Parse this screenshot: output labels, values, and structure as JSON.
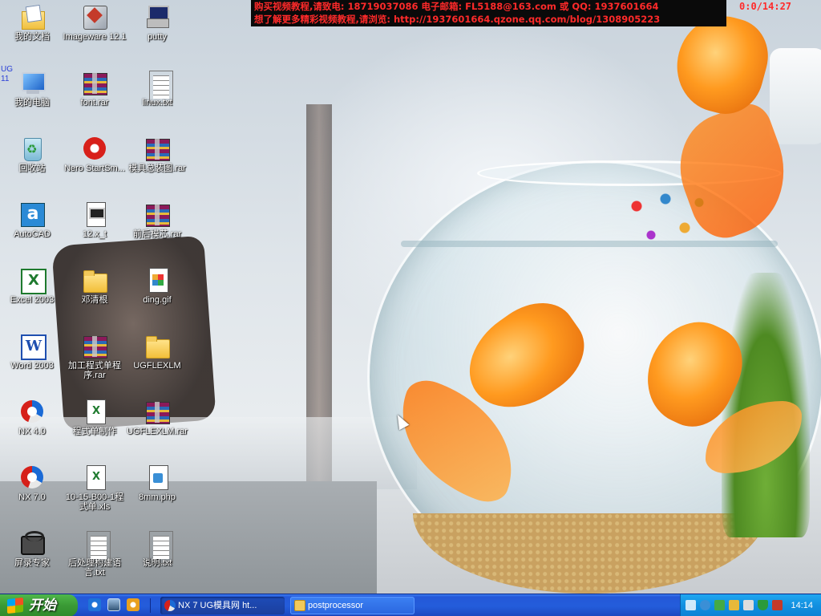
{
  "banner": {
    "line1": "购买视频教程,请致电: 18719037086 电子邮箱: FL5188@163.com 或 QQ: 1937601664",
    "line2": "想了解更多精彩视频教程,请浏览: http://1937601664.qzone.qq.com/blog/1308905223",
    "timer": "0:0/14:27"
  },
  "ug_label": "UG 11",
  "desktop": {
    "icons": [
      {
        "label": "我的文档",
        "icon": "my-documents-icon"
      },
      {
        "label": "Imageware 12.1",
        "icon": "imageware-icon"
      },
      {
        "label": "putty",
        "icon": "putty-icon"
      },
      {
        "label": "我的电脑",
        "icon": "my-computer-icon"
      },
      {
        "label": "font.rar",
        "icon": "rar-archive-icon"
      },
      {
        "label": "linux.txt",
        "icon": "text-file-icon"
      },
      {
        "label": "回收站",
        "icon": "recycle-bin-icon"
      },
      {
        "label": "Nero StartSm...",
        "icon": "nero-icon"
      },
      {
        "label": "模具总装图.rar",
        "icon": "rar-archive-icon"
      },
      {
        "label": "AutoCAD",
        "icon": "autocad-icon"
      },
      {
        "label": "12.x_t",
        "icon": "model-file-icon"
      },
      {
        "label": "前后模芯.rar",
        "icon": "rar-archive-icon"
      },
      {
        "label": "Excel 2003",
        "icon": "excel-icon"
      },
      {
        "label": "邓清根",
        "icon": "folder-icon"
      },
      {
        "label": "ding.gif",
        "icon": "gif-image-icon"
      },
      {
        "label": "Word 2003",
        "icon": "word-icon"
      },
      {
        "label": "加工程式单程序.rar",
        "icon": "rar-archive-icon"
      },
      {
        "label": "UGFLEXLM",
        "icon": "folder-icon"
      },
      {
        "label": "NX 4.0",
        "icon": "nx-icon"
      },
      {
        "label": "程式单制作",
        "icon": "excel-file-icon"
      },
      {
        "label": "UGFLEXLM.rar",
        "icon": "rar-archive-icon"
      },
      {
        "label": "NX 7.0",
        "icon": "nx-icon"
      },
      {
        "label": "10-15-B00-1程式单.xls",
        "icon": "excel-file-icon"
      },
      {
        "label": "8mm.php",
        "icon": "php-file-icon"
      },
      {
        "label": "屏录专家",
        "icon": "screen-recorder-icon"
      },
      {
        "label": "后处理构建语言.txt",
        "icon": "text-file-icon"
      },
      {
        "label": "说明.txt",
        "icon": "text-file-icon"
      }
    ]
  },
  "taskbar": {
    "start_label": "开始",
    "quick_launch": [
      "internet-explorer-icon",
      "show-desktop-icon",
      "media-player-icon"
    ],
    "tasks": [
      {
        "label": "NX 7 UG模具网 ht...",
        "icon": "nx-icon",
        "active": true
      },
      {
        "label": "postprocessor",
        "icon": "folder-icon",
        "active": false
      }
    ],
    "clock": "14:14"
  },
  "colors": {
    "banner_text": "#ff2a2a",
    "taskbar_blue": "#245ddb",
    "start_green": "#3a9a35",
    "tray_blue": "#1290e0"
  }
}
